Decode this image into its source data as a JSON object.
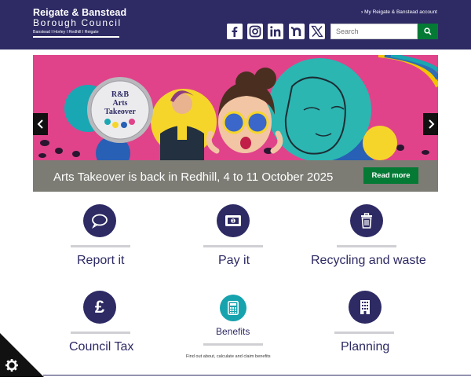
{
  "header": {
    "logo": {
      "line1": "Reigate & Banstead",
      "line2": "Borough Council",
      "line3": "Banstead I Horley I Redhill I Reigate"
    },
    "account_link": "My Reigate & Banstead account",
    "social_icons": [
      "facebook-icon",
      "instagram-icon",
      "linkedin-icon",
      "nextdoor-icon",
      "x-icon"
    ],
    "search": {
      "placeholder": "Search",
      "value": ""
    }
  },
  "hero": {
    "badge": {
      "line1": "R&B",
      "line2": "Arts",
      "line3": "Takeover"
    },
    "caption": "Arts Takeover is back in Redhill, 4 to 11 October 2025",
    "read_more": "Read more"
  },
  "services": [
    {
      "label": "Report it",
      "icon": "speech-bubble-icon"
    },
    {
      "label": "Pay it",
      "icon": "banknote-icon"
    },
    {
      "label": "Recycling and waste",
      "icon": "bin-icon"
    },
    {
      "label": "Council Tax",
      "icon": "pound-icon"
    },
    {
      "label": "Benefits",
      "icon": "calculator-icon",
      "description": "Find out about, calculate and claim benefits"
    },
    {
      "label": "Planning",
      "icon": "building-icon"
    }
  ],
  "colors": {
    "brand": "#2d2a64",
    "green": "#047a35",
    "teal": "#16a3ae",
    "hero_pink": "#e0438a",
    "caption_bg": "#7c7c74"
  }
}
